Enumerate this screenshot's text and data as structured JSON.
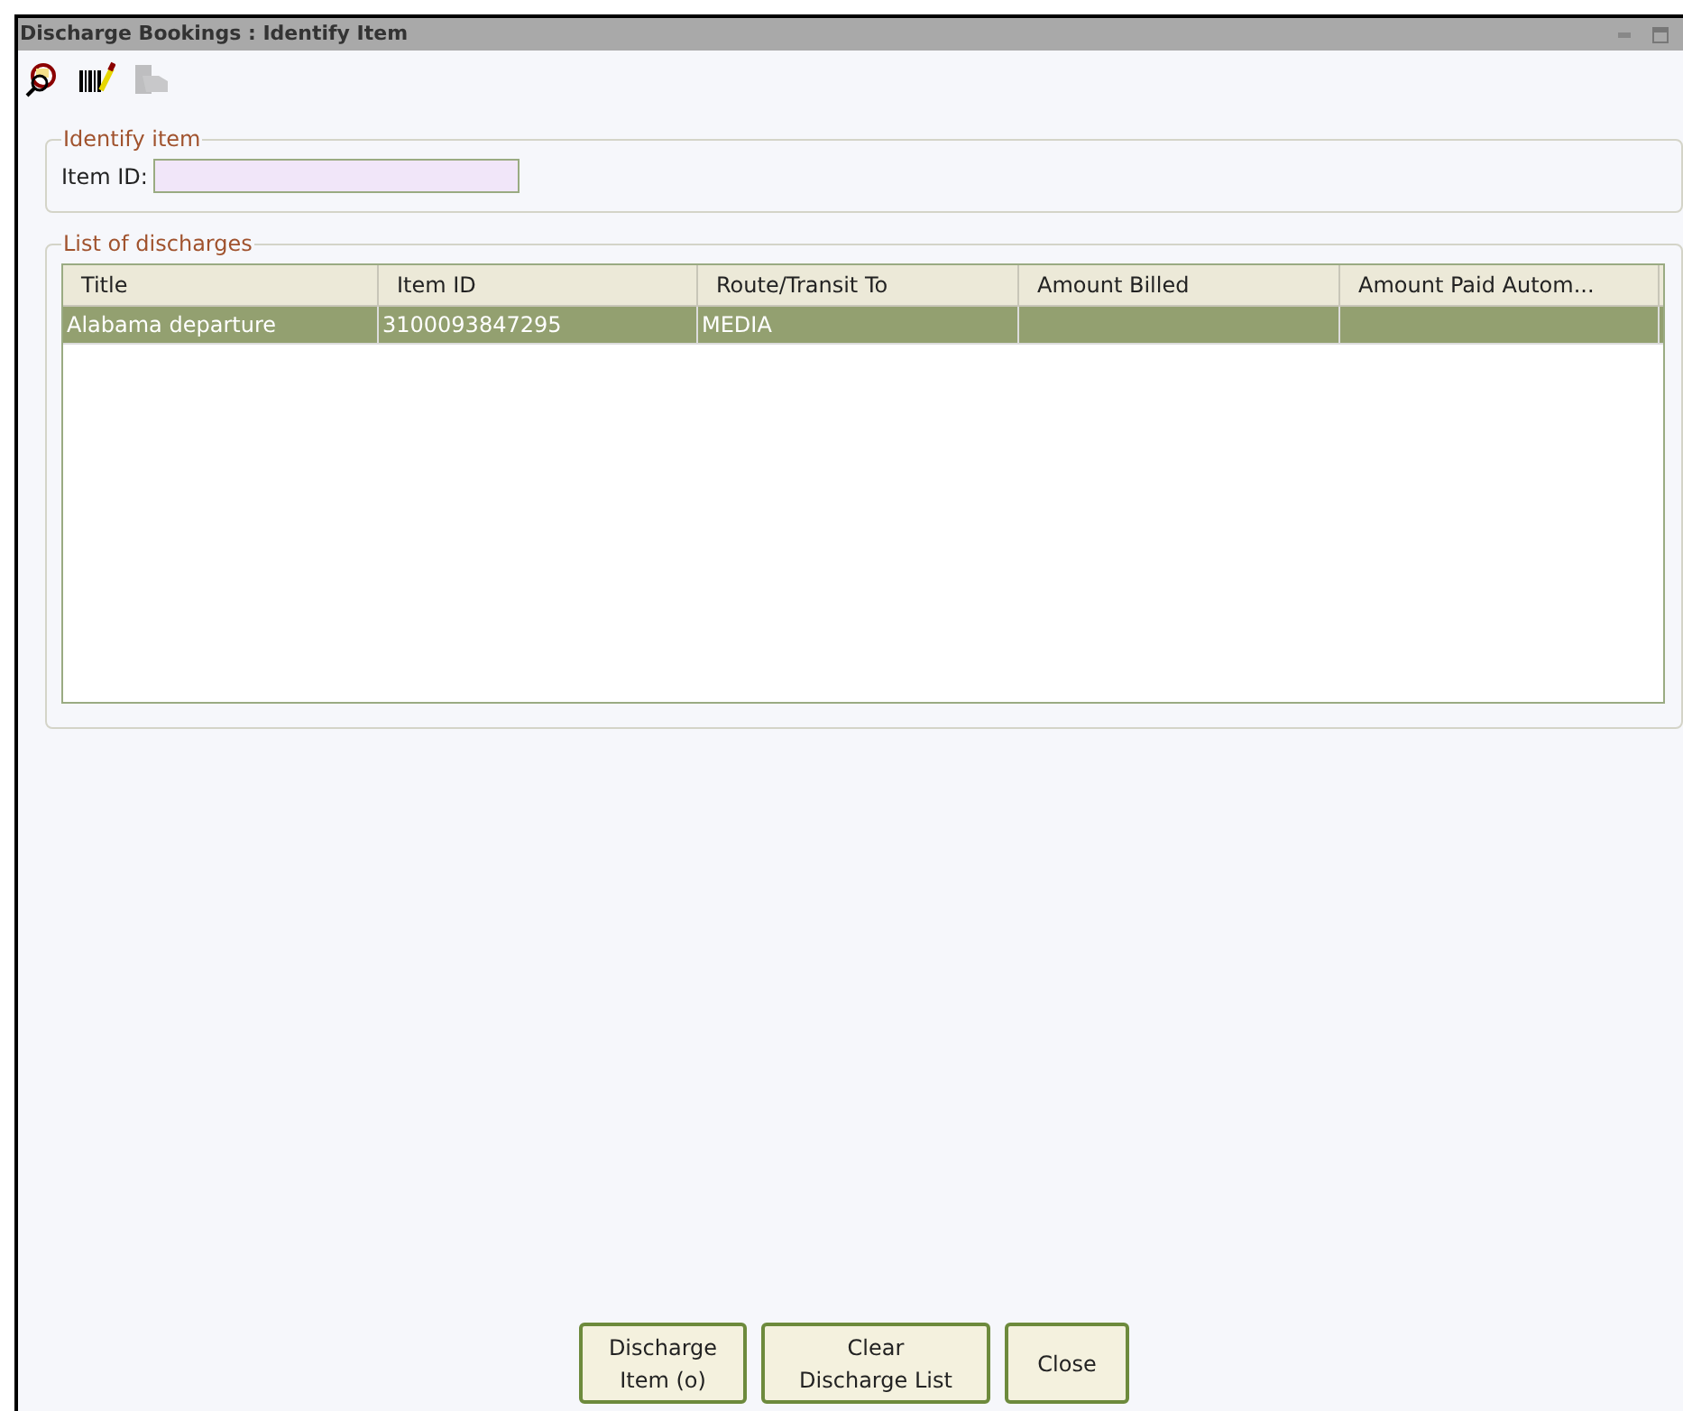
{
  "window": {
    "title": "Discharge Bookings : Identify Item"
  },
  "toolbar": [
    {
      "kind": "search",
      "disabled": false
    },
    {
      "kind": "barcode",
      "disabled": false
    },
    {
      "kind": "hand",
      "disabled": true
    }
  ],
  "identify_item": {
    "legend": "Identify item",
    "label": "Item ID:"
  },
  "discharges": {
    "legend": "List of discharges",
    "columns": [
      "Title",
      "Item ID",
      "Route/Transit To",
      "Amount Billed",
      "Amount Paid Autom..."
    ],
    "rows": [
      {
        "cells": [
          "Alabama departure",
          "3100093847295",
          "MEDIA",
          null,
          null
        ],
        "selected": true
      }
    ]
  },
  "buttons": [
    [
      "Discharge",
      "Item (o)"
    ],
    [
      "Clear",
      "Discharge List"
    ],
    [
      "Close"
    ]
  ]
}
